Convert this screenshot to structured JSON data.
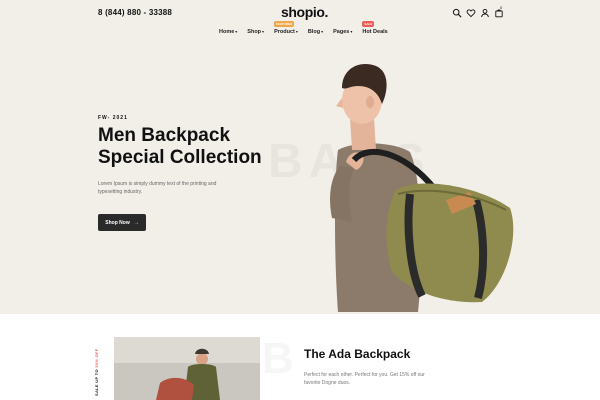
{
  "header": {
    "phone": "8 (844) 880 - 33388",
    "logo": "shopio.",
    "cart_count": "0"
  },
  "nav": {
    "items": [
      {
        "label": "Home",
        "chevron": "▾"
      },
      {
        "label": "Shop",
        "chevron": "▾"
      },
      {
        "label": "Product",
        "chevron": "▾",
        "badge": "FEATURED"
      },
      {
        "label": "Blog",
        "chevron": "▾"
      },
      {
        "label": "Pages",
        "chevron": "▾"
      },
      {
        "label": "Hot Deals",
        "badge": "SALE"
      }
    ]
  },
  "hero": {
    "eyebrow": "FW- 2021",
    "title_line1": "Men Backpack",
    "title_line2": "Special Collection",
    "description": "Lorem Ipsum is simply dummy text of the printing and typesetting industry.",
    "button_label": "Shop Now",
    "button_arrow": "→",
    "watermark": "BAGS"
  },
  "section2": {
    "sale_text": "SALE UP TO",
    "sale_percent": "30% OFF",
    "product_title": "The Ada Backpack",
    "product_desc": "Perfect for each other. Perfect for you. Get 15% off our favorite Dogne duos.",
    "watermark_letter": "B"
  },
  "colors": {
    "hero_bg": "#f2efe9",
    "button_bg": "#2a2a2a",
    "badge_orange": "#f2a64a",
    "badge_red": "#ef5b5b",
    "bag_olive": "#8f8a4d"
  },
  "icons": [
    "search-icon",
    "heart-icon",
    "user-icon",
    "cart-icon"
  ]
}
